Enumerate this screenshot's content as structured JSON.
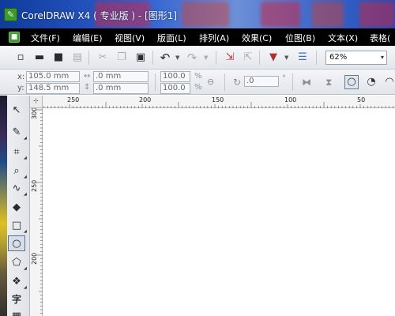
{
  "window": {
    "title": "CorelDRAW X4 ( 专业版 ) - [图形1]",
    "logo_glyph": "✎"
  },
  "menu": {
    "items": [
      "文件(F)",
      "编辑(E)",
      "视图(V)",
      "版面(L)",
      "排列(A)",
      "效果(C)",
      "位图(B)",
      "文本(X)",
      "表格("
    ]
  },
  "toolbar": {
    "zoom_value": "62%",
    "zoom_caret": "▾",
    "icons": [
      "new-icon",
      "open-icon",
      "save-icon",
      "print-icon",
      "cut-icon",
      "copy-icon",
      "paste-icon",
      "undo-icon",
      "redo-icon",
      "import-icon",
      "export-icon",
      "application-launcher-icon",
      "welcome-screen-icon"
    ]
  },
  "property_bar": {
    "x_label": "x:",
    "y_label": "y:",
    "x_value": "105.0 mm",
    "y_value": "148.5 mm",
    "width_value": ".0 mm",
    "height_value": ".0 mm",
    "scale_x": "100.0",
    "scale_y": "100.0",
    "percent_x": "%",
    "percent_y": "%",
    "angle_value": ".0",
    "degree_symbol": "°"
  },
  "ruler": {
    "corner_mark": "⊹",
    "h_labels": [
      "250",
      "200",
      "150",
      "100",
      "50"
    ],
    "v_labels": [
      "300",
      "250",
      "200"
    ]
  },
  "toolbox": {
    "text_tool_label": "字",
    "tools": [
      "pick-tool-icon",
      "shape-tool-icon",
      "crop-tool-icon",
      "zoom-tool-icon",
      "freehand-tool-icon",
      "smart-fill-tool-icon",
      "rectangle-tool-icon",
      "ellipse-tool-icon",
      "polygon-tool-icon",
      "basic-shapes-tool-icon",
      "text-tool-icon"
    ]
  },
  "colors": {
    "titlebar_start": "#0f3b9a",
    "menubar_bg": "#000000",
    "toolbar_bg": "#e3e6eb",
    "canvas_bg": "#ffffff"
  }
}
